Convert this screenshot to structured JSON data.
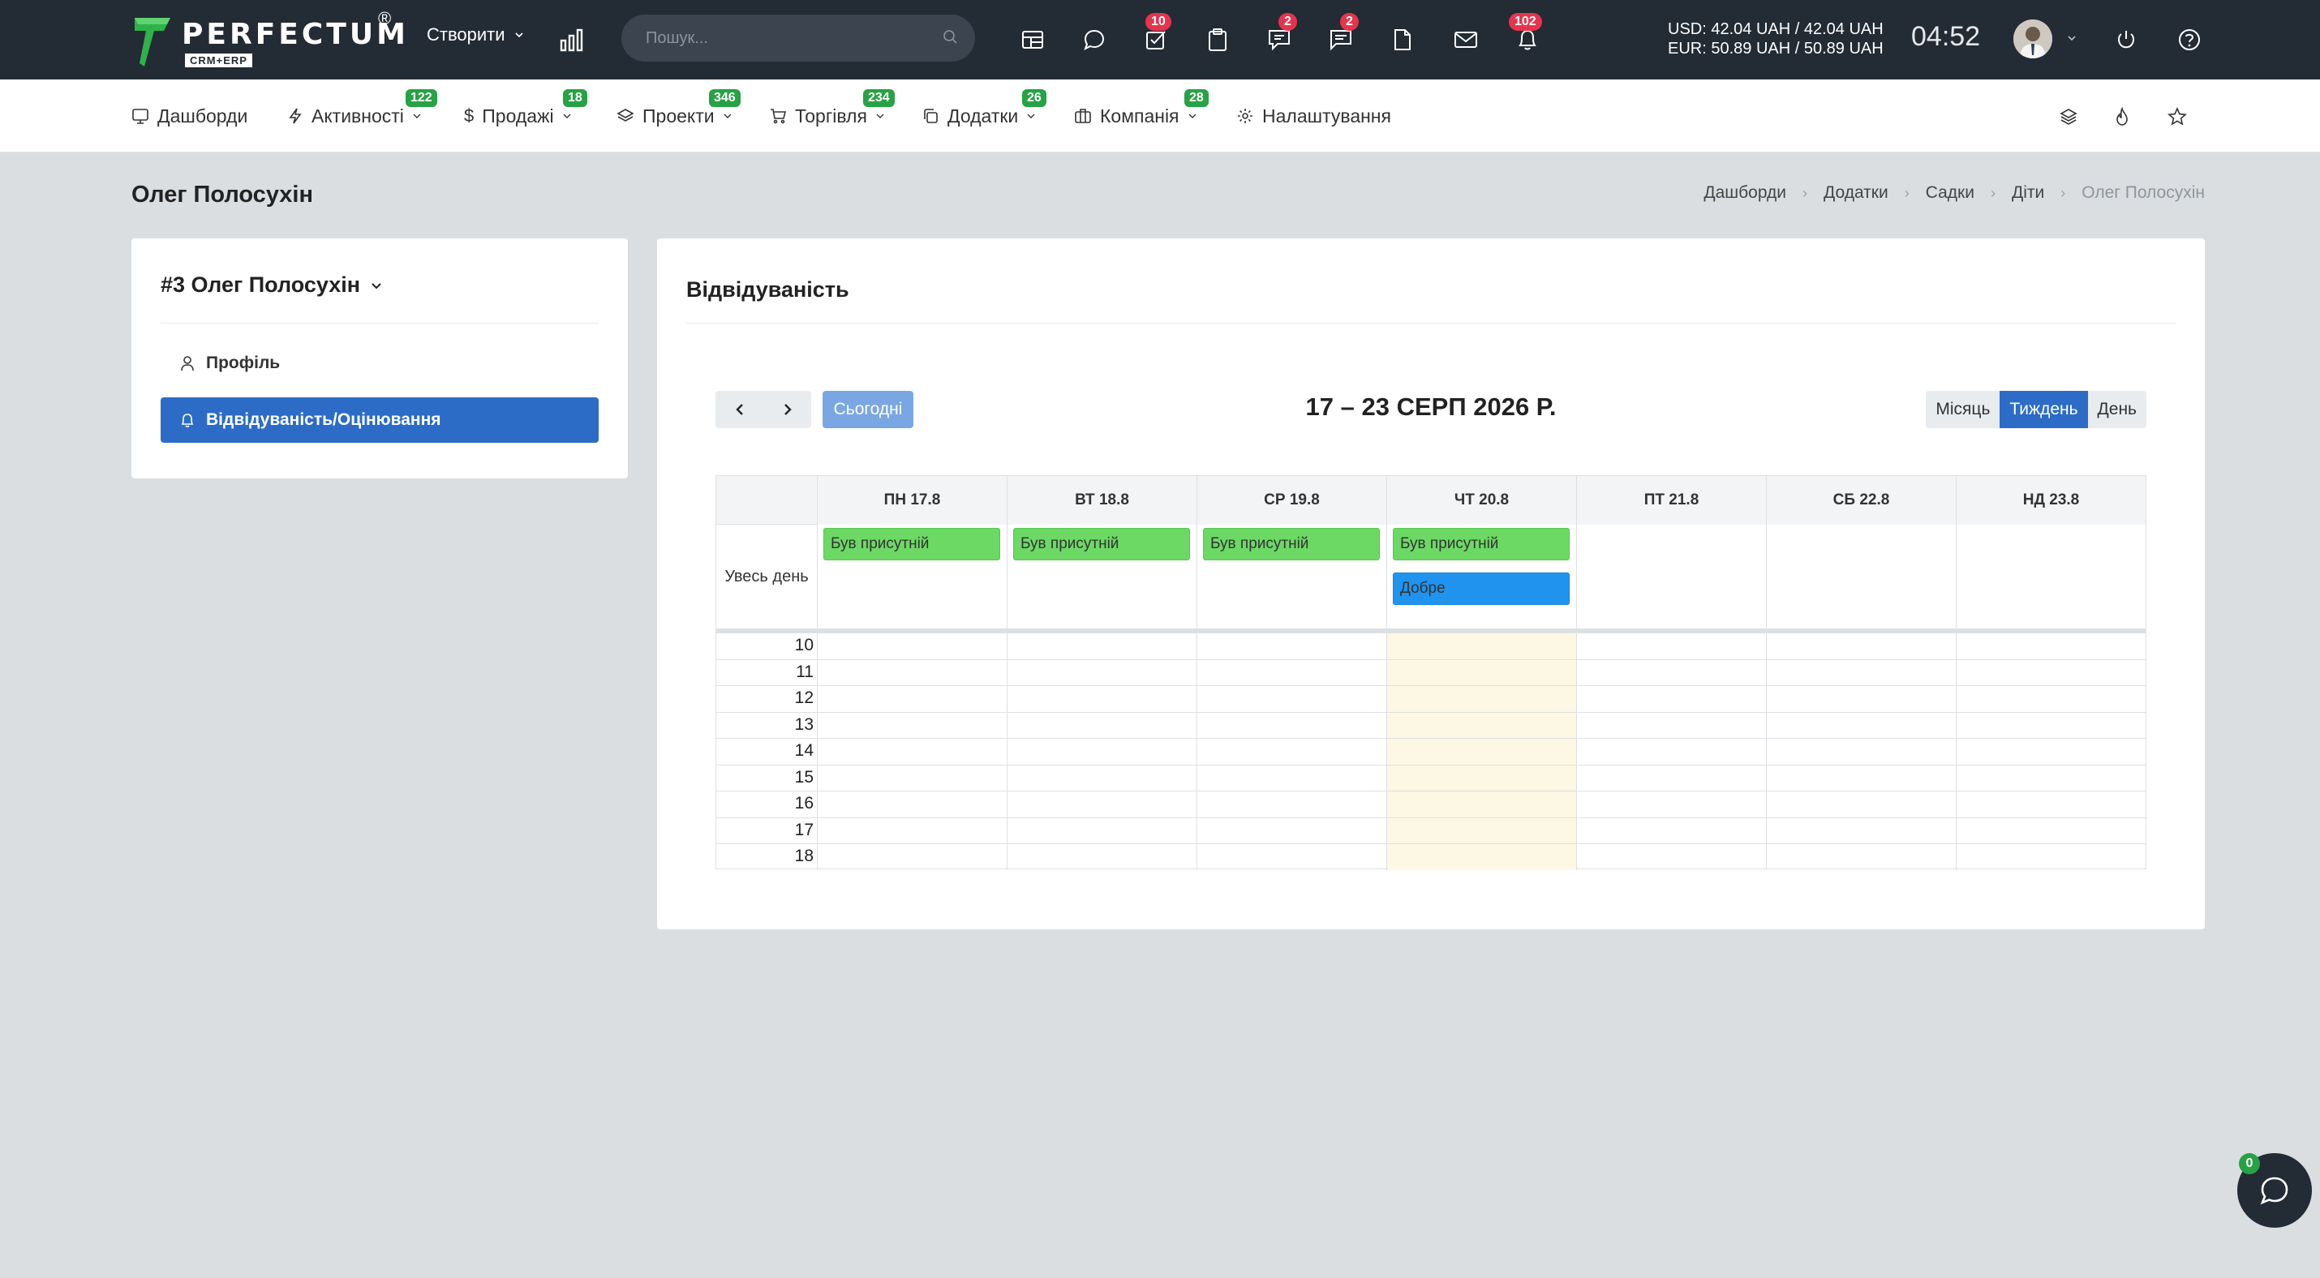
{
  "brand": {
    "name": "PERFECTUM",
    "reg": "®",
    "sub": "CRM+ERP"
  },
  "topbar": {
    "create_label": "Створити",
    "search_placeholder": "Пошук...",
    "badges": {
      "tasks": "10",
      "chat": "2",
      "comments": "2",
      "notifications": "102"
    },
    "currency_usd": "USD: 42.04 UAH / 42.04 UAH",
    "currency_eur": "EUR: 50.89 UAH / 50.89 UAH",
    "clock": "04:52"
  },
  "nav": {
    "dashboards": "Дашборди",
    "activities": "Активності",
    "activities_badge": "122",
    "sales": "Продажі",
    "sales_badge": "18",
    "projects": "Проекти",
    "projects_badge": "346",
    "trade": "Торгівля",
    "trade_badge": "234",
    "addons": "Додатки",
    "addons_badge": "26",
    "company": "Компанія",
    "company_badge": "28",
    "settings": "Налаштування"
  },
  "page": {
    "title": "Олег Полосухін"
  },
  "breadcrumbs": [
    "Дашборди",
    "Додатки",
    "Садки",
    "Діти",
    "Олег Полосухін"
  ],
  "sidebar": {
    "title": "#3 Олег Полосухін",
    "items": [
      {
        "label": "Профіль",
        "icon": "user-icon",
        "active": false
      },
      {
        "label": "Відвідуваність/Оцінювання",
        "icon": "bell-icon",
        "active": true
      }
    ]
  },
  "attendance": {
    "title": "Відвідуваність",
    "today_label": "Сьогодні",
    "range_title": "17 – 23 СЕРП 2026 Р.",
    "views": {
      "month": "Місяць",
      "week": "Тиждень",
      "day": "День",
      "active": "week"
    },
    "days": [
      "ПН 17.8",
      "ВТ 18.8",
      "СР 19.8",
      "ЧТ 20.8",
      "ПТ 21.8",
      "СБ 22.8",
      "НД 23.8"
    ],
    "today_index": 3,
    "all_day_label": "Увесь день",
    "events": [
      {
        "day": 0,
        "label": "Був присутній",
        "color": "#6cd965"
      },
      {
        "day": 1,
        "label": "Був присутній",
        "color": "#6cd965"
      },
      {
        "day": 2,
        "label": "Був присутній",
        "color": "#6cd965"
      },
      {
        "day": 3,
        "label": "Був присутній",
        "color": "#6cd965"
      },
      {
        "day": 3,
        "label": "Добре",
        "color": "#1f93ee"
      }
    ],
    "hours": [
      "10",
      "11",
      "12",
      "13",
      "14",
      "15",
      "16",
      "17",
      "18"
    ]
  },
  "chat_widget": {
    "badge": "0"
  },
  "colors": {
    "topbar": "#232b35",
    "accent": "#2c6cc7",
    "badge_red": "#e5344d",
    "badge_green": "#27a245",
    "today_column": "#fcf8e3"
  }
}
